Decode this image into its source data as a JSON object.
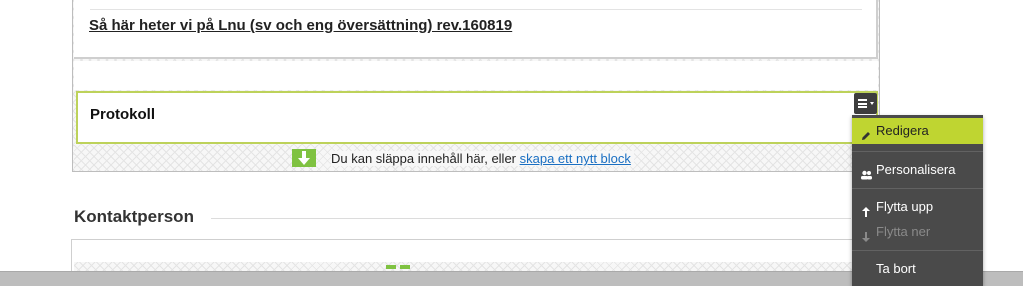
{
  "link_block": {
    "link_text": "Så här heter vi på Lnu (sv och eng översättning) rev.160819"
  },
  "protokoll_block": {
    "title": "Protokoll",
    "menu_button_icon": "hamburger-menu-icon"
  },
  "drop_zone": {
    "text": "Du kan släppa innehåll här, eller ",
    "link": "skapa ett nytt block",
    "icon": "download-arrow-icon"
  },
  "kontakt": {
    "title": "Kontaktperson"
  },
  "menu": {
    "items": [
      {
        "label": "Redigera",
        "icon": "pencil-icon",
        "state": "active"
      },
      {
        "label": "Personalisera",
        "icon": "users-icon",
        "state": "normal"
      },
      {
        "label": "Flytta upp",
        "icon": "arrow-up-icon",
        "state": "normal"
      },
      {
        "label": "Flytta ner",
        "icon": "arrow-down-icon",
        "state": "disabled"
      },
      {
        "label": "Ta bort",
        "icon": "",
        "state": "normal"
      }
    ]
  },
  "colors": {
    "accent": "#bfd531",
    "menu_bg": "#4a4a4a",
    "link": "#1a6fc2",
    "drop_green": "#7fc241"
  }
}
